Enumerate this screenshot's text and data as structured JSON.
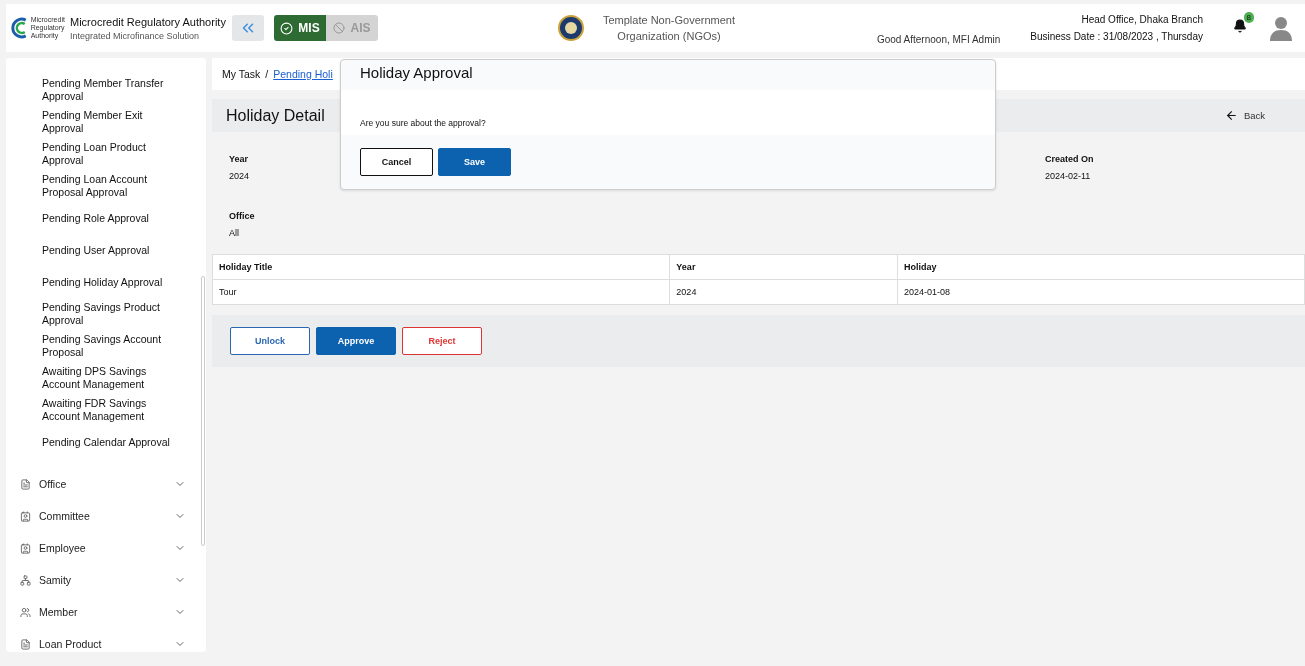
{
  "header": {
    "org_name": "Microcredit Regulatory Authority",
    "org_subtitle": "Integrated Microfinance Solution",
    "logo_text": "Microcredit Regulatory Authority",
    "modules": [
      {
        "label": "MIS",
        "selected": true
      },
      {
        "label": "AIS",
        "selected": false
      }
    ],
    "ngo_name": "Template Non-Government Organization (NGOs)",
    "greeting": "Good Afternoon, MFI Admin",
    "branch": "Head Office, Dhaka Branch",
    "business_date": "Business Date : 31/08/2023 , Thursday",
    "notification_count": "8"
  },
  "sidebar": {
    "task_items": [
      "Pending Member Transfer Approval",
      "Pending Member Exit Approval",
      "Pending Loan Product Approval",
      "Pending Loan Account Proposal Approval",
      "Pending Role Approval",
      "Pending User Approval",
      "Pending Holiday Approval",
      "Pending Savings Product Approval",
      "Pending Savings Account Proposal",
      "Awaiting DPS Savings Account Management",
      "Awaiting FDR Savings Account Management",
      "Pending Calendar Approval"
    ],
    "menu": [
      {
        "label": "Office",
        "kind": "doc"
      },
      {
        "label": "Committee",
        "kind": "people"
      },
      {
        "label": "Employee",
        "kind": "people"
      },
      {
        "label": "Samity",
        "kind": "group"
      },
      {
        "label": "Member",
        "kind": "members"
      },
      {
        "label": "Loan Product",
        "kind": "doc"
      }
    ]
  },
  "breadcrumb": {
    "root": "My Task",
    "separator": "/",
    "link": "Pending Holi"
  },
  "page": {
    "title": "Holiday Detail",
    "back": "Back",
    "fields": [
      {
        "label": "Year",
        "value": "2024"
      },
      {
        "label": "Created On",
        "value": "2024-02-11"
      },
      {
        "label": "Office",
        "value": "All"
      }
    ],
    "table": {
      "columns": [
        "Holiday Title",
        "Year",
        "Holiday"
      ],
      "rows": [
        [
          "Tour",
          "2024",
          "2024-01-08"
        ]
      ]
    },
    "actions": [
      {
        "label": "Unlock",
        "kind": "outline"
      },
      {
        "label": "Approve",
        "kind": "primary"
      },
      {
        "label": "Reject",
        "kind": "danger"
      }
    ]
  },
  "dialog": {
    "title": "Holiday Approval",
    "message": "Are you sure about the approval?",
    "buttons": [
      {
        "label": "Cancel",
        "kind": "outline"
      },
      {
        "label": "Save",
        "kind": "primary"
      }
    ]
  }
}
